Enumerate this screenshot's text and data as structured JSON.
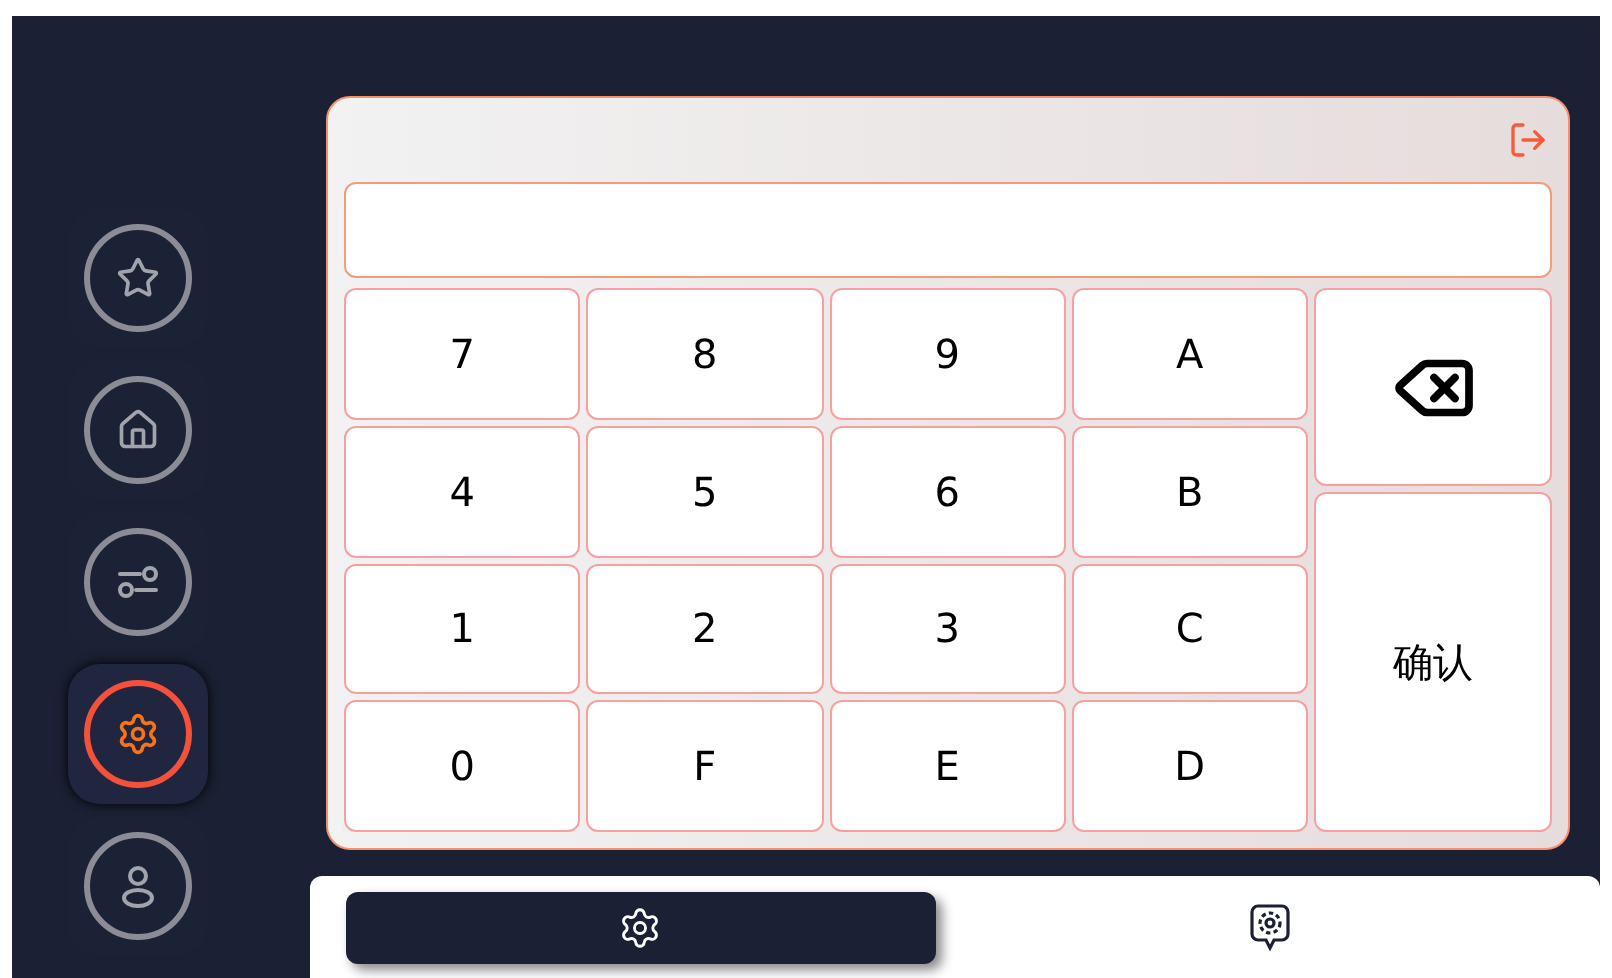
{
  "nav": [
    {
      "kind": "star",
      "selected": false
    },
    {
      "kind": "home",
      "selected": false
    },
    {
      "kind": "sliders",
      "selected": false
    },
    {
      "kind": "gear",
      "selected": true
    },
    {
      "kind": "user",
      "selected": false
    }
  ],
  "keypad": {
    "rows": [
      [
        "7",
        "8",
        "9",
        "A"
      ],
      [
        "4",
        "5",
        "6",
        "B"
      ],
      [
        "1",
        "2",
        "3",
        "C"
      ],
      [
        "0",
        "F",
        "E",
        "D"
      ]
    ],
    "confirm": "确认"
  },
  "tabs": [
    {
      "kind": "gear-edit",
      "selected": true
    },
    {
      "kind": "gear-pin",
      "selected": false
    }
  ]
}
